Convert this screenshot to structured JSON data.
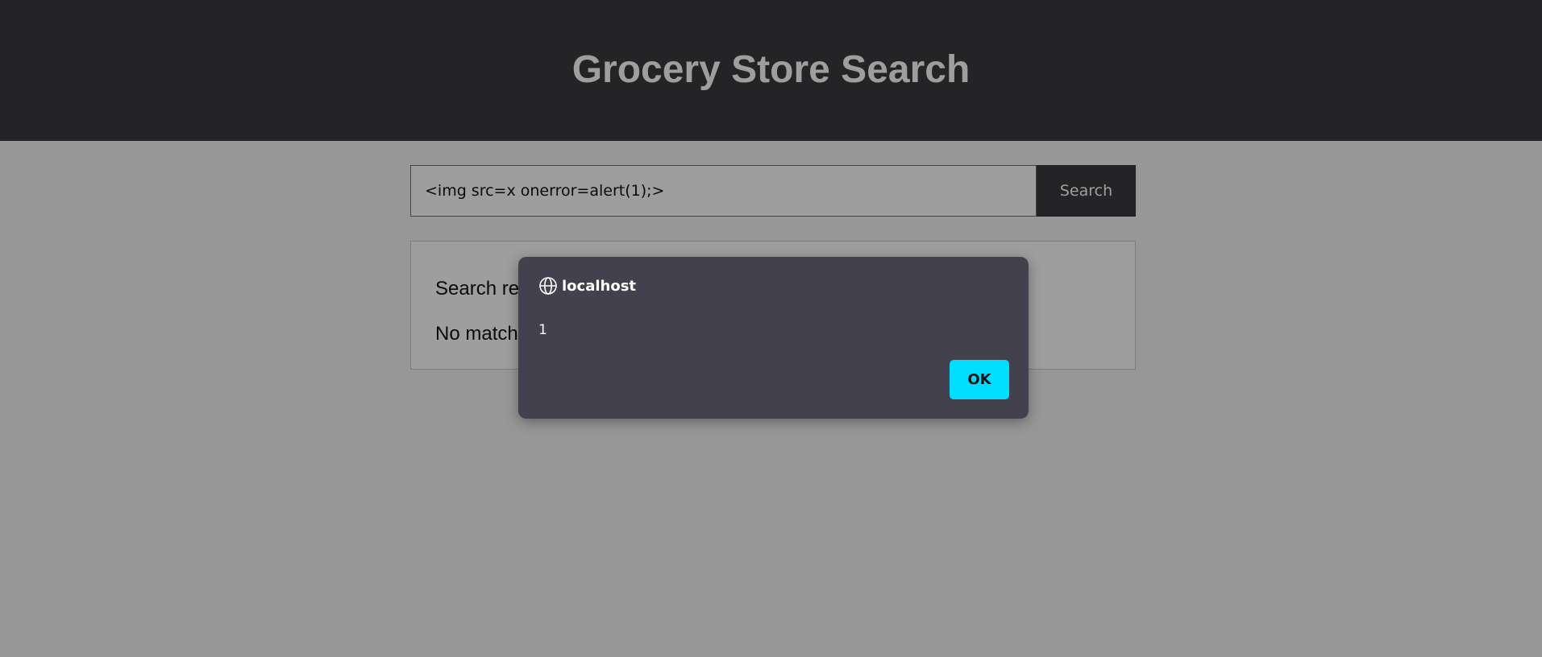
{
  "header": {
    "title": "Grocery Store Search"
  },
  "search": {
    "value": "<img src=x onerror=alert(1);>",
    "button_label": "Search"
  },
  "results": {
    "heading": "Search results for:",
    "message": "No matches found"
  },
  "alert": {
    "origin": "localhost",
    "origin_icon": "globe-icon",
    "message": "1",
    "ok_label": "OK",
    "accent_color": "#00ddff"
  }
}
